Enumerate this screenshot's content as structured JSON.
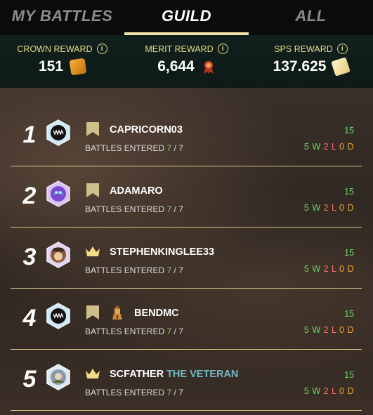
{
  "tabs": [
    {
      "label": "MY BATTLES",
      "active": false
    },
    {
      "label": "GUILD",
      "active": true
    },
    {
      "label": "ALL",
      "active": false
    }
  ],
  "rewards": [
    {
      "label": "CROWN REWARD",
      "value": "151",
      "icon": "crown-icon"
    },
    {
      "label": "MERIT REWARD",
      "value": "6,644",
      "icon": "merit-icon"
    },
    {
      "label": "SPS REWARD",
      "value": "137.625",
      "icon": "sps-icon"
    }
  ],
  "info_glyph": "i",
  "battles_label": "BATTLES ENTERED",
  "players": [
    {
      "rank": "1",
      "name": "CAPRICORN03",
      "title": "",
      "badge": "banner",
      "guild_icon": false,
      "battles": "7",
      "battles_total": "7",
      "score": "15",
      "wins": "5",
      "losses": "2",
      "draws": "0",
      "avatar": "monster"
    },
    {
      "rank": "2",
      "name": "ADAMARO",
      "title": "",
      "badge": "banner",
      "guild_icon": false,
      "battles": "7",
      "battles_total": "7",
      "score": "15",
      "wins": "5",
      "losses": "2",
      "draws": "0",
      "avatar": "dragon"
    },
    {
      "rank": "3",
      "name": "STEPHENKINGLEE33",
      "title": "",
      "badge": "crown",
      "guild_icon": false,
      "battles": "7",
      "battles_total": "7",
      "score": "15",
      "wins": "5",
      "losses": "2",
      "draws": "0",
      "avatar": "pirate"
    },
    {
      "rank": "4",
      "name": "BENDMC",
      "title": "",
      "badge": "banner",
      "guild_icon": true,
      "battles": "7",
      "battles_total": "7",
      "score": "15",
      "wins": "5",
      "losses": "2",
      "draws": "0",
      "avatar": "monster"
    },
    {
      "rank": "5",
      "name": "SCFATHER",
      "title": "THE VETERAN",
      "badge": "crown",
      "guild_icon": false,
      "battles": "7",
      "battles_total": "7",
      "score": "15",
      "wins": "5",
      "losses": "2",
      "draws": "0",
      "avatar": "veteran"
    }
  ],
  "record_letters": {
    "w": "W",
    "l": "L",
    "d": "D"
  },
  "colors": {
    "accent": "#f1e2a6",
    "gold": "#e9d98a",
    "win": "#6fd46b",
    "loss": "#ff6b6b",
    "draw": "#f2a636",
    "title": "#6fb8c4"
  }
}
